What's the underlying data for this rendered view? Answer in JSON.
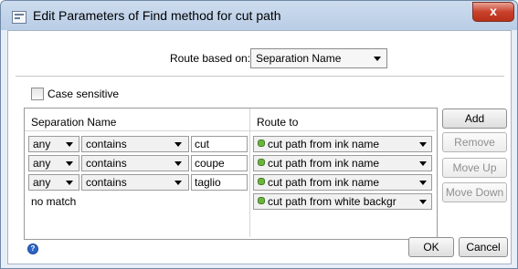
{
  "window": {
    "title": "Edit Parameters of Find method for cut path",
    "close_label": "x"
  },
  "route": {
    "label": "Route based on:",
    "value": "Separation Name"
  },
  "case_sensitive": {
    "label": "Case sensitive",
    "checked": false
  },
  "table": {
    "headers": [
      "Separation Name",
      "Route to"
    ],
    "rows": [
      {
        "qualifier": "any",
        "operator": "contains",
        "text": "cut",
        "route": "cut path from ink name"
      },
      {
        "qualifier": "any",
        "operator": "contains",
        "text": "coupe",
        "route": "cut path from ink name"
      },
      {
        "qualifier": "any",
        "operator": "contains",
        "text": "taglio",
        "route": "cut path from ink name"
      },
      {
        "no_match": "no match",
        "route": "cut path from white backgr"
      }
    ]
  },
  "side_buttons": {
    "add": "Add",
    "remove": "Remove",
    "move_up": "Move Up",
    "move_down": "Move Down"
  },
  "footer": {
    "help_icon": "?",
    "ok": "OK",
    "cancel": "Cancel"
  },
  "colors": {
    "route_dot": "#6cb33f",
    "title_gradient_top": "#cddcee",
    "close_button": "#c9422c",
    "help_icon": "#2c65c8"
  }
}
